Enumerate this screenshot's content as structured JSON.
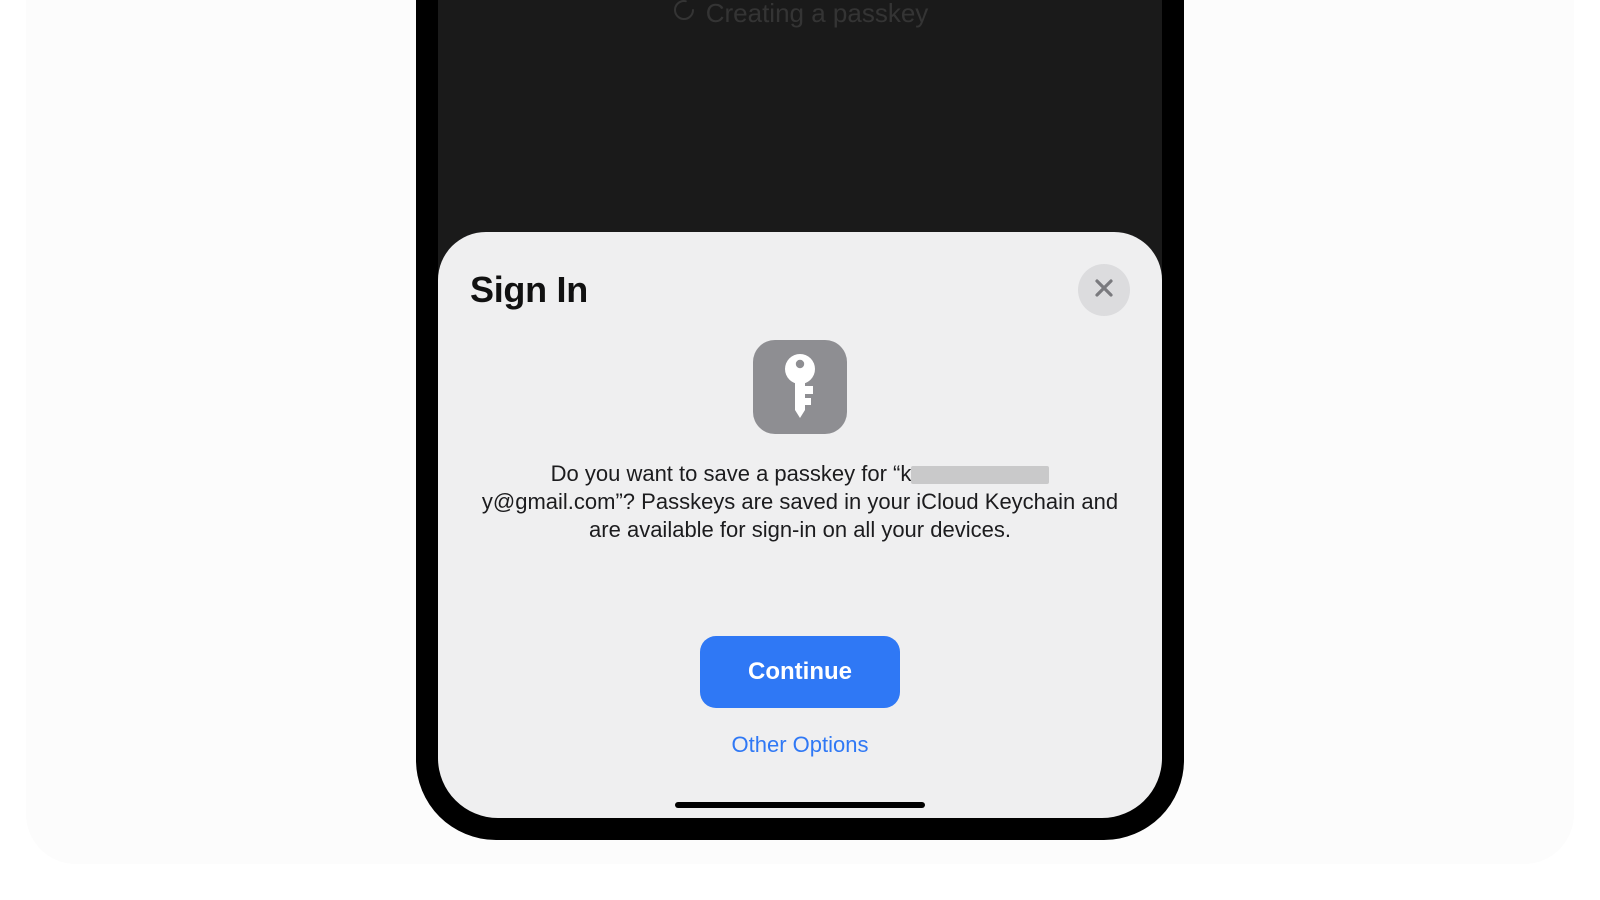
{
  "background": {
    "status_label": "Creating a passkey"
  },
  "sheet": {
    "title": "Sign In",
    "close_icon": "close-icon",
    "key_icon": "key-icon",
    "body_prefix": "Do you want to save a passkey for “k",
    "body_email_suffix": "y@gmail.com”?",
    "body_rest": " Passkeys are saved in your iCloud Keychain and are available for sign-in on all your devices.",
    "continue_label": "Continue",
    "other_label": "Other Options"
  },
  "colors": {
    "accent": "#2f78f5",
    "sheet_bg": "#efeff0",
    "key_badge": "#8e8e92",
    "close_bg": "#dcdcde"
  }
}
